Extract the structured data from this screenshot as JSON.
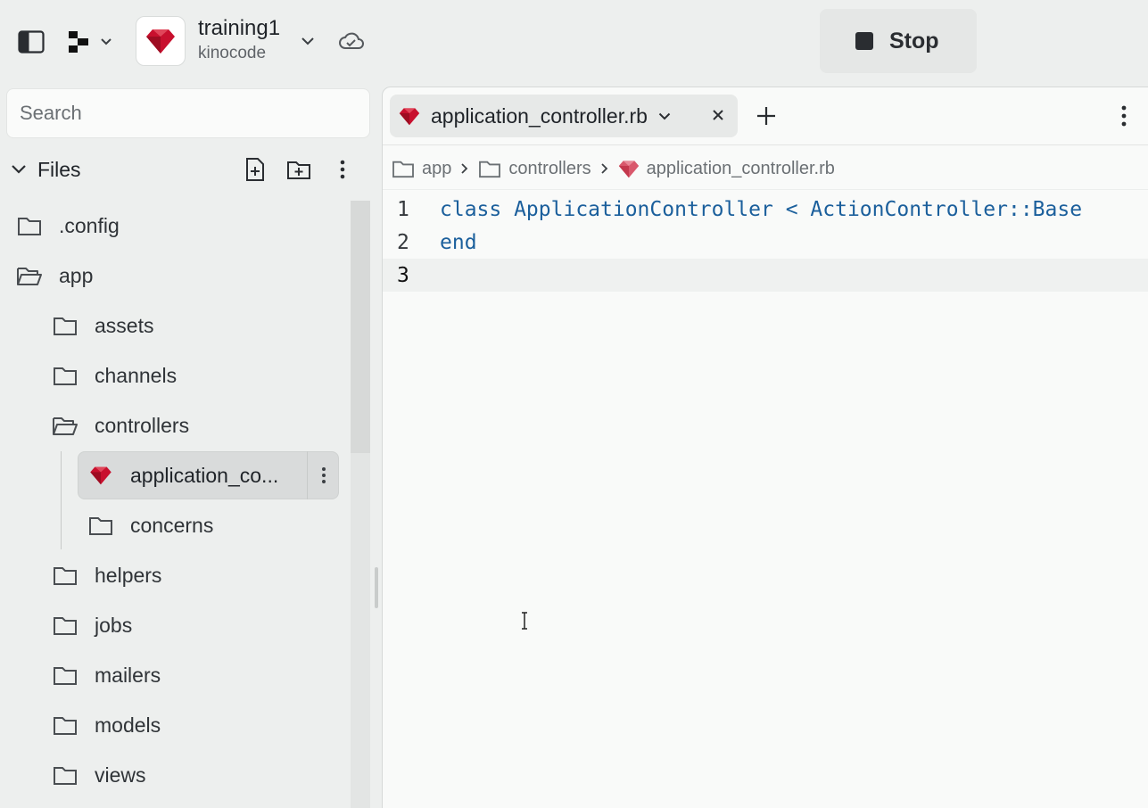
{
  "topbar": {
    "repo_name": "training1",
    "repo_owner": "kinocode",
    "stop_label": "Stop"
  },
  "sidebar": {
    "search_placeholder": "Search",
    "files_title": "Files",
    "tree": [
      {
        "label": ".config",
        "type": "folder"
      },
      {
        "label": "app",
        "type": "folder-open"
      },
      {
        "label": "assets",
        "type": "folder"
      },
      {
        "label": "channels",
        "type": "folder"
      },
      {
        "label": "controllers",
        "type": "folder-open"
      },
      {
        "label": "application_co...",
        "type": "ruby-file",
        "selected": true
      },
      {
        "label": "concerns",
        "type": "folder"
      },
      {
        "label": "helpers",
        "type": "folder"
      },
      {
        "label": "jobs",
        "type": "folder"
      },
      {
        "label": "mailers",
        "type": "folder"
      },
      {
        "label": "models",
        "type": "folder"
      },
      {
        "label": "views",
        "type": "folder"
      }
    ]
  },
  "editor": {
    "tab_title": "application_controller.rb",
    "breadcrumb": [
      "app",
      "controllers",
      "application_controller.rb"
    ],
    "lines": [
      {
        "num": "1",
        "code": "class ApplicationController < ActionController::Base"
      },
      {
        "num": "2",
        "code": "end"
      },
      {
        "num": "3",
        "code": ""
      }
    ]
  },
  "colors": {
    "ruby_red": "#c8102e",
    "keyword_blue": "#1b5f9c",
    "background": "#edefee"
  }
}
